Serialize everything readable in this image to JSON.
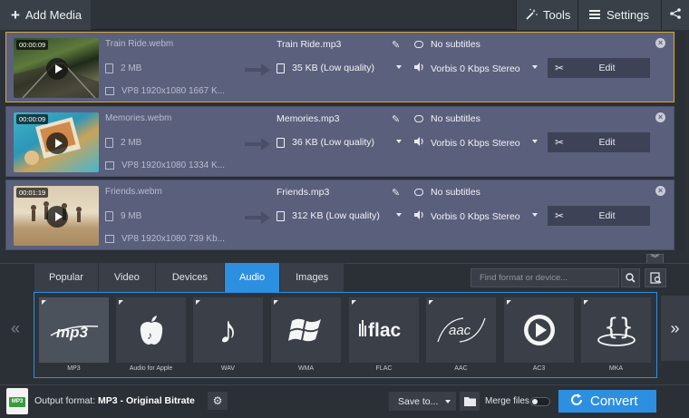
{
  "toolbar": {
    "add_media": "Add Media",
    "tools": "Tools",
    "settings": "Settings"
  },
  "files": [
    {
      "duration": "00:00:09",
      "source_name": "Train Ride.webm",
      "source_size": "2 MB",
      "source_info": "VP8 1920x1080 1667 K...",
      "output_name": "Train Ride.mp3",
      "output_size": "35 KB (Low quality)",
      "subtitles": "No subtitles",
      "audio": "Vorbis 0 Kbps Stereo",
      "edit": "Edit",
      "selected": true
    },
    {
      "duration": "00:00:09",
      "source_name": "Memories.webm",
      "source_size": "2 MB",
      "source_info": "VP8 1920x1080 1334 K...",
      "output_name": "Memories.mp3",
      "output_size": "36 KB (Low quality)",
      "subtitles": "No subtitles",
      "audio": "Vorbis 0 Kbps Stereo",
      "edit": "Edit",
      "selected": false
    },
    {
      "duration": "00:01:19",
      "source_name": "Friends.webm",
      "source_size": "9 MB",
      "source_info": "VP8 1920x1080 739 Kb...",
      "output_name": "Friends.mp3",
      "output_size": "312 KB (Low quality)",
      "subtitles": "No subtitles",
      "audio": "Vorbis 0 Kbps Stereo",
      "edit": "Edit",
      "selected": false
    }
  ],
  "tabs": [
    "Popular",
    "Video",
    "Devices",
    "Audio",
    "Images"
  ],
  "active_tab": "Audio",
  "search": {
    "placeholder": "Find format or device..."
  },
  "formats": [
    {
      "label": "MP3",
      "logo": "mp3"
    },
    {
      "label": "Audio for Apple",
      "logo": "apple"
    },
    {
      "label": "WAV",
      "logo": "note"
    },
    {
      "label": "WMA",
      "logo": "windows"
    },
    {
      "label": "FLAC",
      "logo": "flac"
    },
    {
      "label": "AAC",
      "logo": "aac"
    },
    {
      "label": "AC3",
      "logo": "play-circle"
    },
    {
      "label": "MKA",
      "logo": "braces"
    }
  ],
  "status": {
    "output_label": "Output format:",
    "output_value": "MP3 - Original Bitrate",
    "save_to": "Save to...",
    "merge_files": "Merge files",
    "convert": "Convert"
  },
  "colors": {
    "accent": "#2d8fe0",
    "selection": "#d9a836",
    "item_bg": "#5a5f7c"
  }
}
